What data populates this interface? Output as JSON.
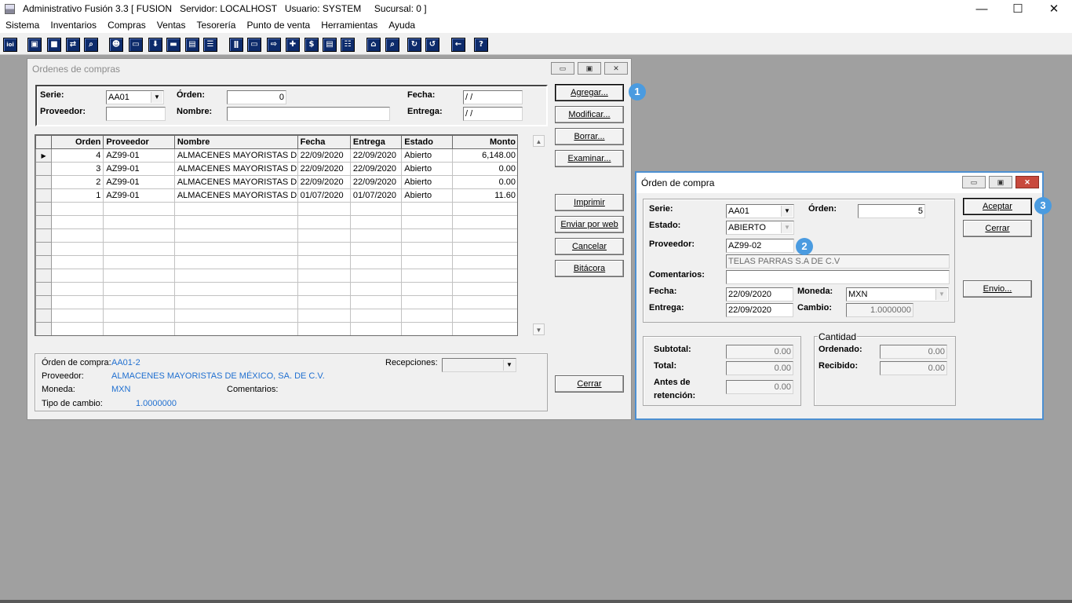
{
  "app": {
    "title": "Administrativo Fusión 3.3 [ FUSION   Servidor: LOCALHOST   Usuario: SYSTEM     Sucursal: 0 ]",
    "minimize": "—",
    "maximize": "☐",
    "close": "✕"
  },
  "menu": [
    "Sistema",
    "Inventarios",
    "Compras",
    "Ventas",
    "Tesorería",
    "Punto de venta",
    "Herramientas",
    "Ayuda"
  ],
  "toolbar": {
    "icons": [
      "ioi-icon",
      "window-icon",
      "clipboard-icon",
      "transfer-icon",
      "search-doc-icon",
      "user-icon",
      "folder-icon",
      "download-icon",
      "print-icon",
      "document-icon",
      "list-icon",
      "people-icon",
      "box-icon",
      "export-icon",
      "add-icon",
      "dollar-icon",
      "report-icon",
      "table-icon",
      "home-icon",
      "find-icon",
      "refresh-icon",
      "undo-icon",
      "back-arrow-icon",
      "help-icon"
    ],
    "glyphs": [
      "ioi",
      "▣",
      "■",
      "⇄",
      "⌕",
      "☻",
      "▭",
      "⬇",
      "▬",
      "▤",
      "☰",
      "ǁ",
      "▭",
      "⇨",
      "✚",
      "$",
      "▤",
      "☷",
      "⌂",
      "⌕",
      "↻",
      "↺",
      "←",
      "?"
    ]
  },
  "ordenes": {
    "title": "Ordenes de compras",
    "serie_label": "Serie:",
    "serie_value": "AA01",
    "orden_label": "Órden:",
    "orden_value": "0",
    "fecha_label": "Fecha:",
    "fecha_value": " / /",
    "proveedor_label": "Proveedor:",
    "proveedor_value": "",
    "nombre_label": "Nombre:",
    "nombre_value": "",
    "entrega_label": "Entrega:",
    "entrega_value": " / /",
    "columns": [
      "Orden",
      "Proveedor",
      "Nombre",
      "Fecha",
      "Entrega",
      "Estado",
      "Monto"
    ],
    "rows": [
      [
        "4",
        "AZ99-01",
        "ALMACENES MAYORISTAS DE M",
        "22/09/2020",
        "22/09/2020",
        "Abierto",
        "6,148.00"
      ],
      [
        "3",
        "AZ99-01",
        "ALMACENES MAYORISTAS DE M",
        "22/09/2020",
        "22/09/2020",
        "Abierto",
        "0.00"
      ],
      [
        "2",
        "AZ99-01",
        "ALMACENES MAYORISTAS DE M",
        "22/09/2020",
        "22/09/2020",
        "Abierto",
        "0.00"
      ],
      [
        "1",
        "AZ99-01",
        "ALMACENES MAYORISTAS DE M",
        "01/07/2020",
        "01/07/2020",
        "Abierto",
        "11.60"
      ]
    ],
    "buttons": {
      "agregar": "Agregar...",
      "modificar": "Modificar...",
      "borrar": "Borrar...",
      "examinar": "Examinar...",
      "imprimir": "Imprimir",
      "enviar_web": "Enviar por web",
      "cancelar": "Cancelar",
      "bitacora": "Bitácora",
      "cerrar": "Cerrar"
    },
    "detail": {
      "orden_compra_label": "Órden de compra:",
      "orden_compra_value": "AA01-2",
      "proveedor_label": "Proveedor:",
      "proveedor_value": "ALMACENES MAYORISTAS DE MÉXICO, SA. DE C.V.",
      "moneda_label": "Moneda:",
      "moneda_value": "MXN",
      "comentarios_label": "Comentarios:",
      "tipo_cambio_label": "Tipo de cambio:",
      "tipo_cambio_value": "1.0000000",
      "recepciones_label": "Recepciones:",
      "recepciones_value": ""
    }
  },
  "orden": {
    "title": "Órden de compra",
    "serie_label": "Serie:",
    "serie_value": "AA01",
    "orden_label": "Órden:",
    "orden_value": "5",
    "estado_label": "Estado:",
    "estado_value": "ABIERTO",
    "proveedor_label": "Proveedor:",
    "proveedor_value": "AZ99-02",
    "proveedor_nombre": "TELAS PARRAS S.A DE C.V",
    "comentarios_label": "Comentarios:",
    "comentarios_value": "",
    "fecha_label": "Fecha:",
    "fecha_value": "22/09/2020",
    "moneda_label": "Moneda:",
    "moneda_value": "MXN",
    "entrega_label": "Entrega:",
    "entrega_value": "22/09/2020",
    "cambio_label": "Cambio:",
    "cambio_value": "1.0000000",
    "subtotal_label": "Subtotal:",
    "subtotal_value": "0.00",
    "total_label": "Total:",
    "total_value": "0.00",
    "antes_label_1": "Antes de",
    "antes_label_2": "retención:",
    "antes_value": "0.00",
    "cantidad_label": "Cantidad",
    "ordenado_label": "Ordenado:",
    "ordenado_value": "0.00",
    "recibido_label": "Recibido:",
    "recibido_value": "0.00",
    "buttons": {
      "aceptar": "Aceptar",
      "cerrar": "Cerrar",
      "envio": "Envio..."
    }
  },
  "badges": [
    "1",
    "2",
    "3"
  ],
  "colors": {
    "badge": "#4a9be0",
    "link_text": "#1f6fd0",
    "close_button": "#c8493d",
    "toolbar_icon": "#0d2b6b"
  }
}
